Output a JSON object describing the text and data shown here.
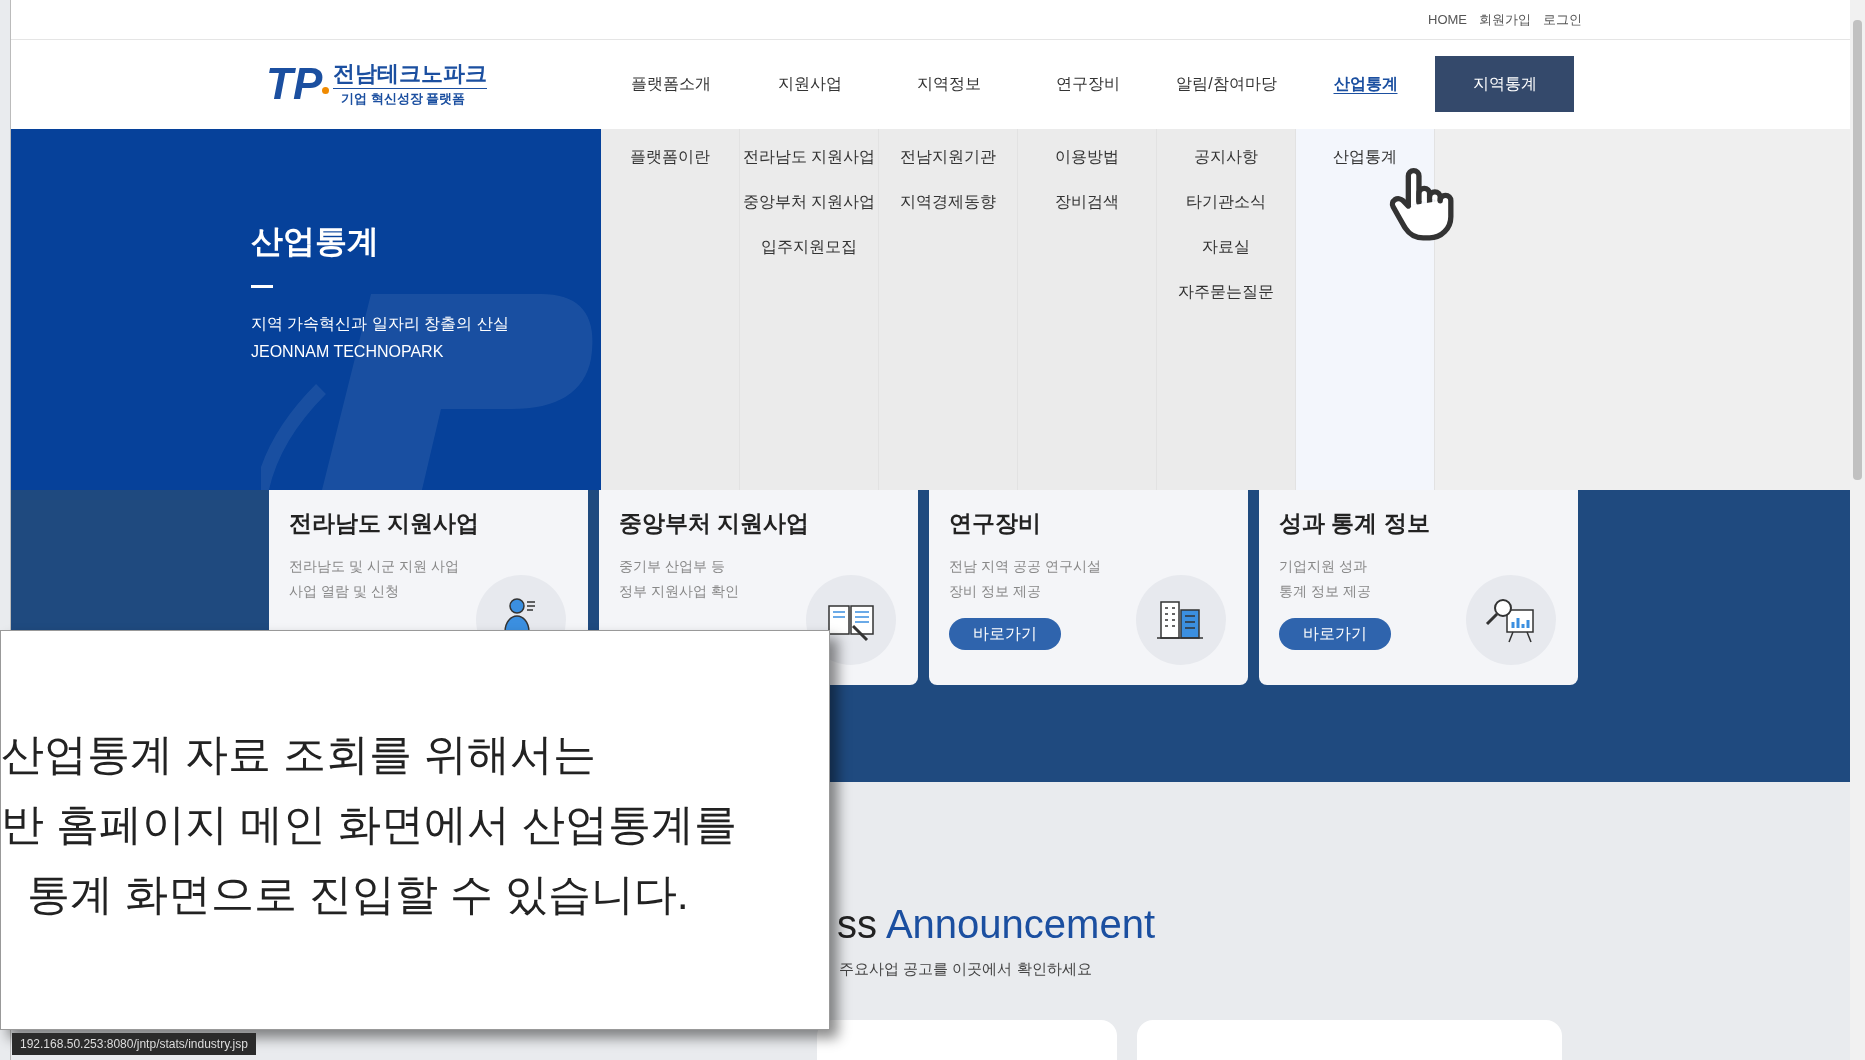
{
  "utility_links": [
    "HOME",
    "회원가입",
    "로그인"
  ],
  "logo": {
    "mark": "TP",
    "name": "전남테크노파크",
    "tagline": "기업 혁신성장 플랫폼"
  },
  "nav": [
    {
      "label": "플랫폼소개",
      "selected": false
    },
    {
      "label": "지원사업",
      "selected": false
    },
    {
      "label": "지역정보",
      "selected": false
    },
    {
      "label": "연구장비",
      "selected": false
    },
    {
      "label": "알림/참여마당",
      "selected": false
    },
    {
      "label": "산업통계",
      "selected": true
    }
  ],
  "nav_button": "지역통계",
  "hero": {
    "title": "산업통계",
    "subtitle": "지역 가속혁신과 일자리 창출의 산실",
    "english": "JEONNAM TECHNOPARK"
  },
  "mega_menu": [
    {
      "selected": false,
      "items": [
        "플랫폼이란"
      ]
    },
    {
      "selected": false,
      "items": [
        "전라남도 지원사업",
        "중앙부처 지원사업",
        "입주지원모집"
      ]
    },
    {
      "selected": false,
      "items": [
        "전남지원기관",
        "지역경제동향"
      ]
    },
    {
      "selected": false,
      "items": [
        "이용방법",
        "장비검색"
      ]
    },
    {
      "selected": false,
      "items": [
        "공지사항",
        "타기관소식",
        "자료실",
        "자주묻는질문"
      ]
    },
    {
      "selected": true,
      "items": [
        "산업통계"
      ]
    }
  ],
  "cards": [
    {
      "title": "전라남도 지원사업",
      "lines": [
        "전라남도 및 시군 지원 사업",
        "사업 열람 및 신청"
      ],
      "kind": "person"
    },
    {
      "title": "중앙부처 지원사업",
      "lines": [
        "중기부 산업부 등",
        "정부 지원사업 확인"
      ],
      "kind": "book"
    },
    {
      "title": "연구장비",
      "lines": [
        "전남 지역 공공 연구시설",
        "장비 정보 제공"
      ],
      "kind": "building",
      "button": "바로가기"
    },
    {
      "title": "성과 통계 정보",
      "lines": [
        "기업지원 성과",
        "통계 정보 제공"
      ],
      "kind": "chart",
      "button": "바로가기"
    }
  ],
  "announcement": {
    "heading_start": "ss",
    "heading_accent": "Announcement",
    "subtitle": "주요사업 공고를 이곳에서 확인하세요"
  },
  "caption": [
    "산업통계 자료 조회를 위해서는",
    "반 홈페이지 메인 화면에서 산업통계를",
    "통계 화면으로 진입할 수 있습니다."
  ],
  "status_url": "192.168.50.253:8080/jntp/stats/industry.jsp"
}
